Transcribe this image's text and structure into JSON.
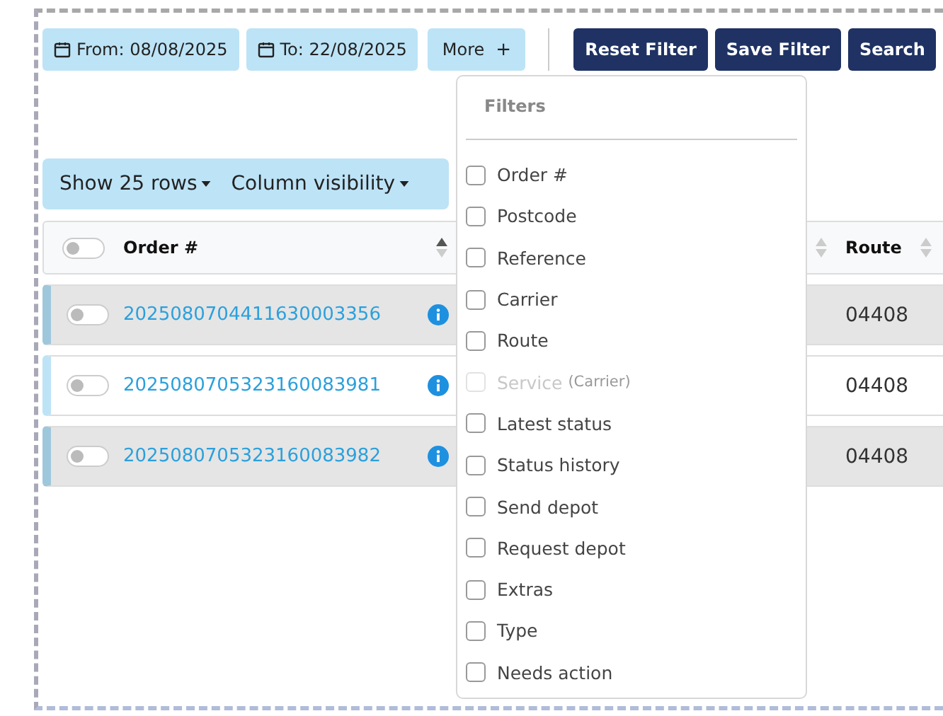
{
  "filters": [
    {
      "kind": "date",
      "label": "From: 08/08/2025"
    },
    {
      "kind": "date",
      "label": "To: 22/08/2025"
    },
    {
      "kind": "more",
      "label": "More",
      "icon_text": "+"
    }
  ],
  "actions": [
    "Reset Filter",
    "Save Filter",
    "Search"
  ],
  "table_toolbar": [
    "Show 25 rows",
    "Column visibility"
  ],
  "table": {
    "select_all_on": false,
    "columns": [
      {
        "label": "Order #",
        "sorted": true
      },
      {
        "sorted": false
      },
      {
        "label": "Route",
        "sorted": false
      }
    ],
    "rows": [
      {
        "highlighted": true,
        "on": false,
        "order": "2025080704411630003356",
        "route": "04408"
      },
      {
        "highlighted": false,
        "on": false,
        "order": "2025080705323160083981",
        "route": "04408"
      },
      {
        "highlighted": true,
        "on": false,
        "order": "2025080705323160083982",
        "route": "04408"
      }
    ]
  },
  "menu": {
    "title": "Filters",
    "items": [
      {
        "label": "Order #",
        "checked": false,
        "disabled": false
      },
      {
        "label": "Postcode",
        "checked": false,
        "disabled": false
      },
      {
        "label": "Reference",
        "checked": false,
        "disabled": false
      },
      {
        "label": "Carrier",
        "checked": false,
        "disabled": false
      },
      {
        "label": "Route",
        "checked": false,
        "disabled": false
      },
      {
        "label": "Service",
        "note": "(Carrier)",
        "checked": false,
        "disabled": true
      },
      {
        "label": "Latest status",
        "checked": false,
        "disabled": false
      },
      {
        "label": "Status history",
        "checked": false,
        "disabled": false
      },
      {
        "label": "Send depot",
        "checked": false,
        "disabled": false
      },
      {
        "label": "Request depot",
        "checked": false,
        "disabled": false
      },
      {
        "label": "Extras",
        "checked": false,
        "disabled": false
      },
      {
        "label": "Type",
        "checked": false,
        "disabled": false
      },
      {
        "label": "Needs action",
        "checked": false,
        "disabled": false
      }
    ]
  }
}
